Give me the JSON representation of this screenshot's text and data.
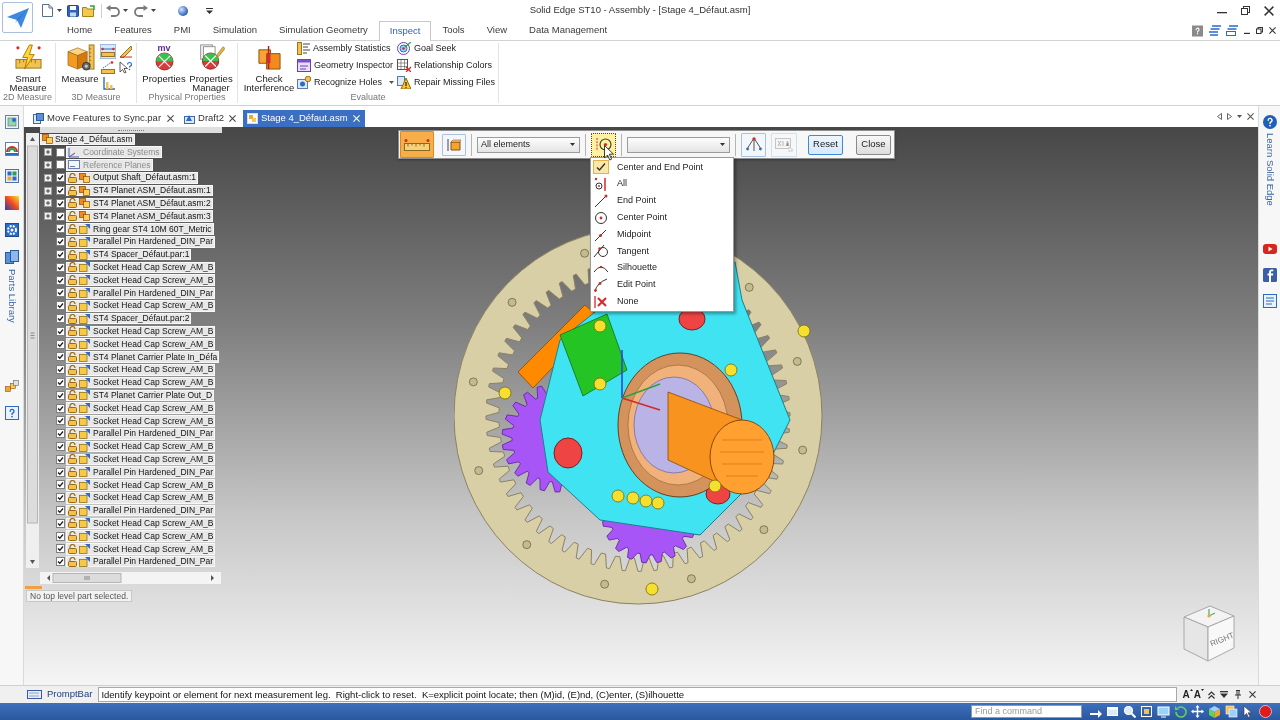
{
  "window": {
    "title": "Solid Edge ST10 - Assembly - [Stage 4_Défaut.asm]"
  },
  "ribbon": {
    "tabs": [
      {
        "label": "Home",
        "selected": false
      },
      {
        "label": "Features",
        "selected": false
      },
      {
        "label": "PMI",
        "selected": false
      },
      {
        "label": "Simulation",
        "selected": false
      },
      {
        "label": "Simulation Geometry",
        "selected": false
      },
      {
        "label": "Inspect",
        "selected": true
      },
      {
        "label": "Tools",
        "selected": false
      },
      {
        "label": "View",
        "selected": false
      },
      {
        "label": "Data Management",
        "selected": false
      }
    ],
    "groups": [
      {
        "label": "2D Measure",
        "buttons": [
          {
            "label": "Smart Measure"
          }
        ]
      },
      {
        "label": "3D Measure",
        "buttons": [
          {
            "label": "Measure"
          }
        ],
        "tools": [
          {
            "selected": true
          },
          {
            "selected": false
          },
          {
            "selected": false
          },
          {
            "selected": false
          },
          {
            "selected": false
          }
        ]
      },
      {
        "label": "Physical Properties",
        "buttons": [
          {
            "label": "Properties",
            "icon_text": "mv"
          },
          {
            "label": "Properties Manager"
          }
        ]
      },
      {
        "label": "Evaluate",
        "buttons": [
          {
            "label": "Check Interference"
          }
        ],
        "commands": [
          {
            "label": "Assembly Statistics",
            "menu": false
          },
          {
            "label": "Geometry Inspector",
            "menu": false
          },
          {
            "label": "Recognize Holes",
            "menu": true
          },
          {
            "label": "Goal Seek",
            "menu": false
          },
          {
            "label": "Relationship Colors",
            "menu": false
          },
          {
            "label": "Repair Missing Files",
            "menu": false
          }
        ]
      }
    ]
  },
  "document_tabs": [
    {
      "label": "Move Features to Sync.par",
      "selected": false
    },
    {
      "label": "Draft2",
      "selected": false
    },
    {
      "label": "Stage 4_Défaut.asm",
      "selected": true
    }
  ],
  "side_panels": {
    "left_label": "Parts Library",
    "right_label": "Learn Solid Edge"
  },
  "tree": {
    "label": "Stage 4_Défaut.asm",
    "children": [
      {
        "label": "Coordinate Systems",
        "kind": "coordinate-systems",
        "checked": false,
        "expanded": false
      },
      {
        "label": "Reference Planes",
        "kind": "reference-planes",
        "checked": false,
        "expanded": false
      },
      {
        "label": "Output Shaft_Défaut.asm:1",
        "kind": "assembly",
        "checked": true,
        "expanded": false
      },
      {
        "label": "ST4 Planet ASM_Défaut.asm:1",
        "kind": "assembly",
        "checked": true,
        "expanded": false
      },
      {
        "label": "ST4 Planet ASM_Défaut.asm:2",
        "kind": "assembly",
        "checked": true,
        "expanded": false
      },
      {
        "label": "ST4 Planet ASM_Défaut.asm:3",
        "kind": "assembly",
        "checked": true,
        "expanded": false
      },
      {
        "label": "Ring gear ST4 10M 60T_Metric",
        "kind": "part",
        "checked": true
      },
      {
        "label": "Parallel Pin Hardened_DIN_Par",
        "kind": "part",
        "checked": true
      },
      {
        "label": "ST4 Spacer_Défaut.par:1",
        "kind": "part",
        "checked": true
      },
      {
        "label": "Socket Head Cap Screw_AM_B",
        "kind": "part",
        "checked": true
      },
      {
        "label": "Socket Head Cap Screw_AM_B",
        "kind": "part",
        "checked": true
      },
      {
        "label": "Parallel Pin Hardened_DIN_Par",
        "kind": "part",
        "checked": true
      },
      {
        "label": "Socket Head Cap Screw_AM_B",
        "kind": "part",
        "checked": true
      },
      {
        "label": "ST4 Spacer_Défaut.par:2",
        "kind": "part",
        "checked": true
      },
      {
        "label": "Socket Head Cap Screw_AM_B",
        "kind": "part",
        "checked": true
      },
      {
        "label": "Socket Head Cap Screw_AM_B",
        "kind": "part",
        "checked": true
      },
      {
        "label": "ST4 Planet Carrier Plate In_Défa",
        "kind": "part",
        "checked": true
      },
      {
        "label": "Socket Head Cap Screw_AM_B",
        "kind": "part",
        "checked": true
      },
      {
        "label": "Socket Head Cap Screw_AM_B",
        "kind": "part",
        "checked": true
      },
      {
        "label": "ST4 Planet Carrier Plate Out_D",
        "kind": "part",
        "checked": true
      },
      {
        "label": "Socket Head Cap Screw_AM_B",
        "kind": "part",
        "checked": true
      },
      {
        "label": "Socket Head Cap Screw_AM_B",
        "kind": "part",
        "checked": true
      },
      {
        "label": "Parallel Pin Hardened_DIN_Par",
        "kind": "part",
        "checked": true
      },
      {
        "label": "Socket Head Cap Screw_AM_B",
        "kind": "part",
        "checked": true
      },
      {
        "label": "Socket Head Cap Screw_AM_B",
        "kind": "part",
        "checked": true
      },
      {
        "label": "Parallel Pin Hardened_DIN_Par",
        "kind": "part",
        "checked": true
      },
      {
        "label": "Socket Head Cap Screw_AM_B",
        "kind": "part",
        "checked": true
      },
      {
        "label": "Socket Head Cap Screw_AM_B",
        "kind": "part",
        "checked": true
      },
      {
        "label": "Parallel Pin Hardened_DIN_Par",
        "kind": "part",
        "checked": true
      },
      {
        "label": "Socket Head Cap Screw_AM_B",
        "kind": "part",
        "checked": true
      },
      {
        "label": "Socket Head Cap Screw_AM_B",
        "kind": "part",
        "checked": true
      },
      {
        "label": "Socket Head Cap Screw_AM_B",
        "kind": "part",
        "checked": true
      },
      {
        "label": "Parallel Pin Hardened_DIN_Par",
        "kind": "part",
        "checked": true
      }
    ]
  },
  "status": "No top level part selected.",
  "command_bar": {
    "items": [
      {
        "kind": "ruler-toggle",
        "selected": true,
        "disabled": false
      },
      {
        "kind": "part-toggle",
        "selected": false,
        "disabled": false
      },
      {
        "kind": "separator"
      },
      {
        "kind": "dropdown",
        "value": "All elements"
      },
      {
        "kind": "separator"
      },
      {
        "kind": "keypoint-toggle",
        "selected": true,
        "disabled": false
      },
      {
        "kind": "separator"
      },
      {
        "kind": "dropdown"
      },
      {
        "kind": "separator"
      },
      {
        "kind": "vertex-toggle",
        "selected": false,
        "disabled": false
      },
      {
        "kind": "dimension-toggle",
        "selected": false,
        "disabled": true
      },
      {
        "kind": "button",
        "label": "Reset",
        "focused": true
      },
      {
        "kind": "button",
        "label": "Close",
        "focused": false
      }
    ]
  },
  "keypoint_menu": {
    "items": [
      {
        "label": "Center and End Point",
        "selected": true
      },
      {
        "label": "All",
        "selected": false
      },
      {
        "label": "End Point",
        "selected": false
      },
      {
        "label": "Center Point",
        "selected": false
      },
      {
        "label": "Midpoint",
        "selected": false
      },
      {
        "label": "Tangent",
        "selected": false
      },
      {
        "label": "Silhouette",
        "selected": false
      },
      {
        "label": "Edit Point",
        "selected": false
      },
      {
        "label": "None",
        "selected": false
      }
    ]
  },
  "view_cube": {
    "label": "RIGHT"
  },
  "prompt_bar": {
    "label": "PromptBar",
    "text": "Identify keypoint or element for next measurement leg.  Right-click to reset.  K=explicit point locate; then (M)id, (E)nd, (C)enter, (S)ilhouette",
    "font_buttons": [
      "A",
      "A"
    ]
  },
  "command_finder": {
    "placeholder": "Find a command"
  }
}
